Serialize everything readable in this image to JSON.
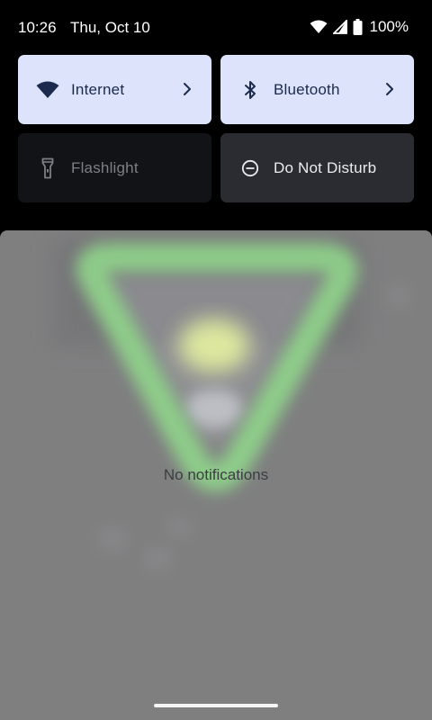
{
  "status_bar": {
    "time": "10:26",
    "date": "Thu, Oct 10",
    "battery_percent": "100%",
    "icons": [
      "wifi-icon",
      "cell-signal-icon",
      "battery-icon"
    ]
  },
  "quick_settings": {
    "tiles": [
      {
        "label": "Internet",
        "icon": "wifi-icon",
        "state": "on",
        "has_chevron": true
      },
      {
        "label": "Bluetooth",
        "icon": "bluetooth-icon",
        "state": "on",
        "has_chevron": true
      },
      {
        "label": "Flashlight",
        "icon": "flashlight-icon",
        "state": "unavailable",
        "has_chevron": false
      },
      {
        "label": "Do Not Disturb",
        "icon": "do-not-disturb-icon",
        "state": "off",
        "has_chevron": false
      }
    ]
  },
  "notifications": {
    "empty_text": "No notifications"
  },
  "colors": {
    "tile_on_bg": "#dce3fb",
    "tile_on_fg": "#1b2a4d",
    "tile_off_bg": "#2b2c31",
    "shade_bg": "#7f7f80",
    "wallpaper_accent": "#8fd08a"
  }
}
